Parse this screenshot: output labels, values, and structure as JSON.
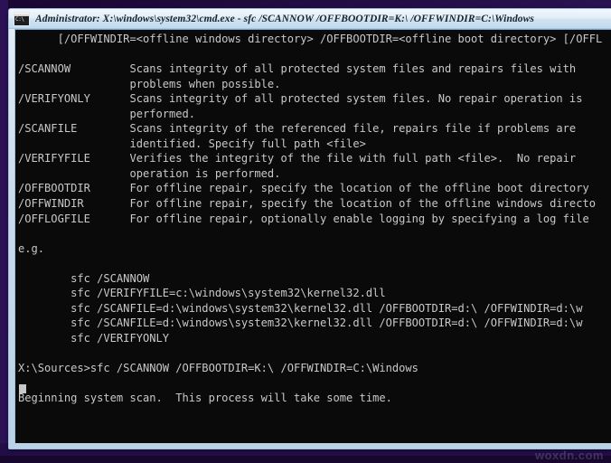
{
  "window": {
    "title": "Administrator: X:\\windows\\system32\\cmd.exe - sfc  /SCANNOW /OFFBOOTDIR=K:\\ /OFFWINDIR=C:\\Windows",
    "icon": "cmd-console-icon",
    "icon_glyph": "C:\\",
    "colors": {
      "titlebar_top": "#f2f8fd",
      "titlebar_bottom": "#c3dbee",
      "frame_border": "#9fc1dc",
      "console_bg": "#0a0a0a",
      "console_fg": "#c8c8c8",
      "desktop_bg": "#1d0a3a"
    }
  },
  "console": {
    "lines": [
      "      [/OFFWINDIR=<offline windows directory> /OFFBOOTDIR=<offline boot directory> [/OFFL",
      "",
      "/SCANNOW         Scans integrity of all protected system files and repairs files with",
      "                 problems when possible.",
      "/VERIFYONLY      Scans integrity of all protected system files. No repair operation is",
      "                 performed.",
      "/SCANFILE        Scans integrity of the referenced file, repairs file if problems are",
      "                 identified. Specify full path <file>",
      "/VERIFYFILE      Verifies the integrity of the file with full path <file>.  No repair",
      "                 operation is performed.",
      "/OFFBOOTDIR      For offline repair, specify the location of the offline boot directory",
      "/OFFWINDIR       For offline repair, specify the location of the offline windows directo",
      "/OFFLOGFILE      For offline repair, optionally enable logging by specifying a log file",
      "",
      "e.g.",
      "",
      "        sfc /SCANNOW",
      "        sfc /VERIFYFILE=c:\\windows\\system32\\kernel32.dll",
      "        sfc /SCANFILE=d:\\windows\\system32\\kernel32.dll /OFFBOOTDIR=d:\\ /OFFWINDIR=d:\\w",
      "        sfc /SCANFILE=d:\\windows\\system32\\kernel32.dll /OFFBOOTDIR=d:\\ /OFFWINDIR=d:\\w",
      "        sfc /VERIFYONLY",
      "",
      "X:\\Sources>sfc /SCANNOW /OFFBOOTDIR=K:\\ /OFFWINDIR=C:\\Windows",
      "",
      "Beginning system scan.  This process will take some time.",
      ""
    ],
    "cursor_visible": true
  },
  "watermark": {
    "text": "woxdn.com"
  }
}
